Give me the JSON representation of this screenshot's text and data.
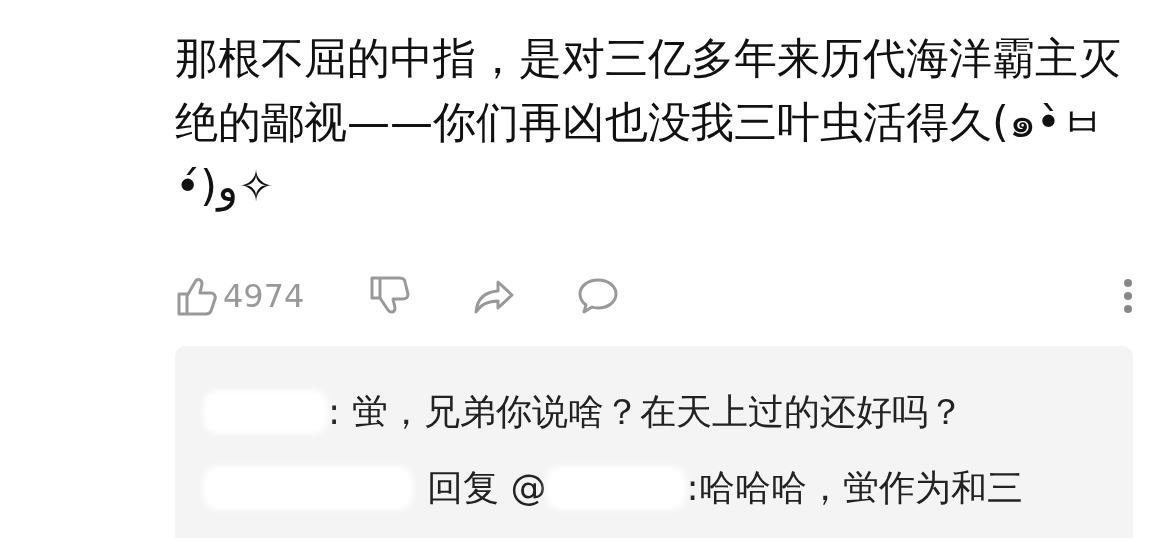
{
  "comment": {
    "text": "那根不屈的中指，是对三亿多年来历代海洋霸主灭绝的鄙视——你们再凶也没我三叶虫活得久(๑•̀ㅂ•́)و✧"
  },
  "actions": {
    "likes": "4974"
  },
  "replies": [
    {
      "kind": "comment",
      "text": ": 蛍，兄弟你说啥？在天上过的还好吗？"
    },
    {
      "kind": "reply",
      "reply_label": "回复 @",
      "text": ":哈哈哈，蛍作为和三"
    }
  ]
}
